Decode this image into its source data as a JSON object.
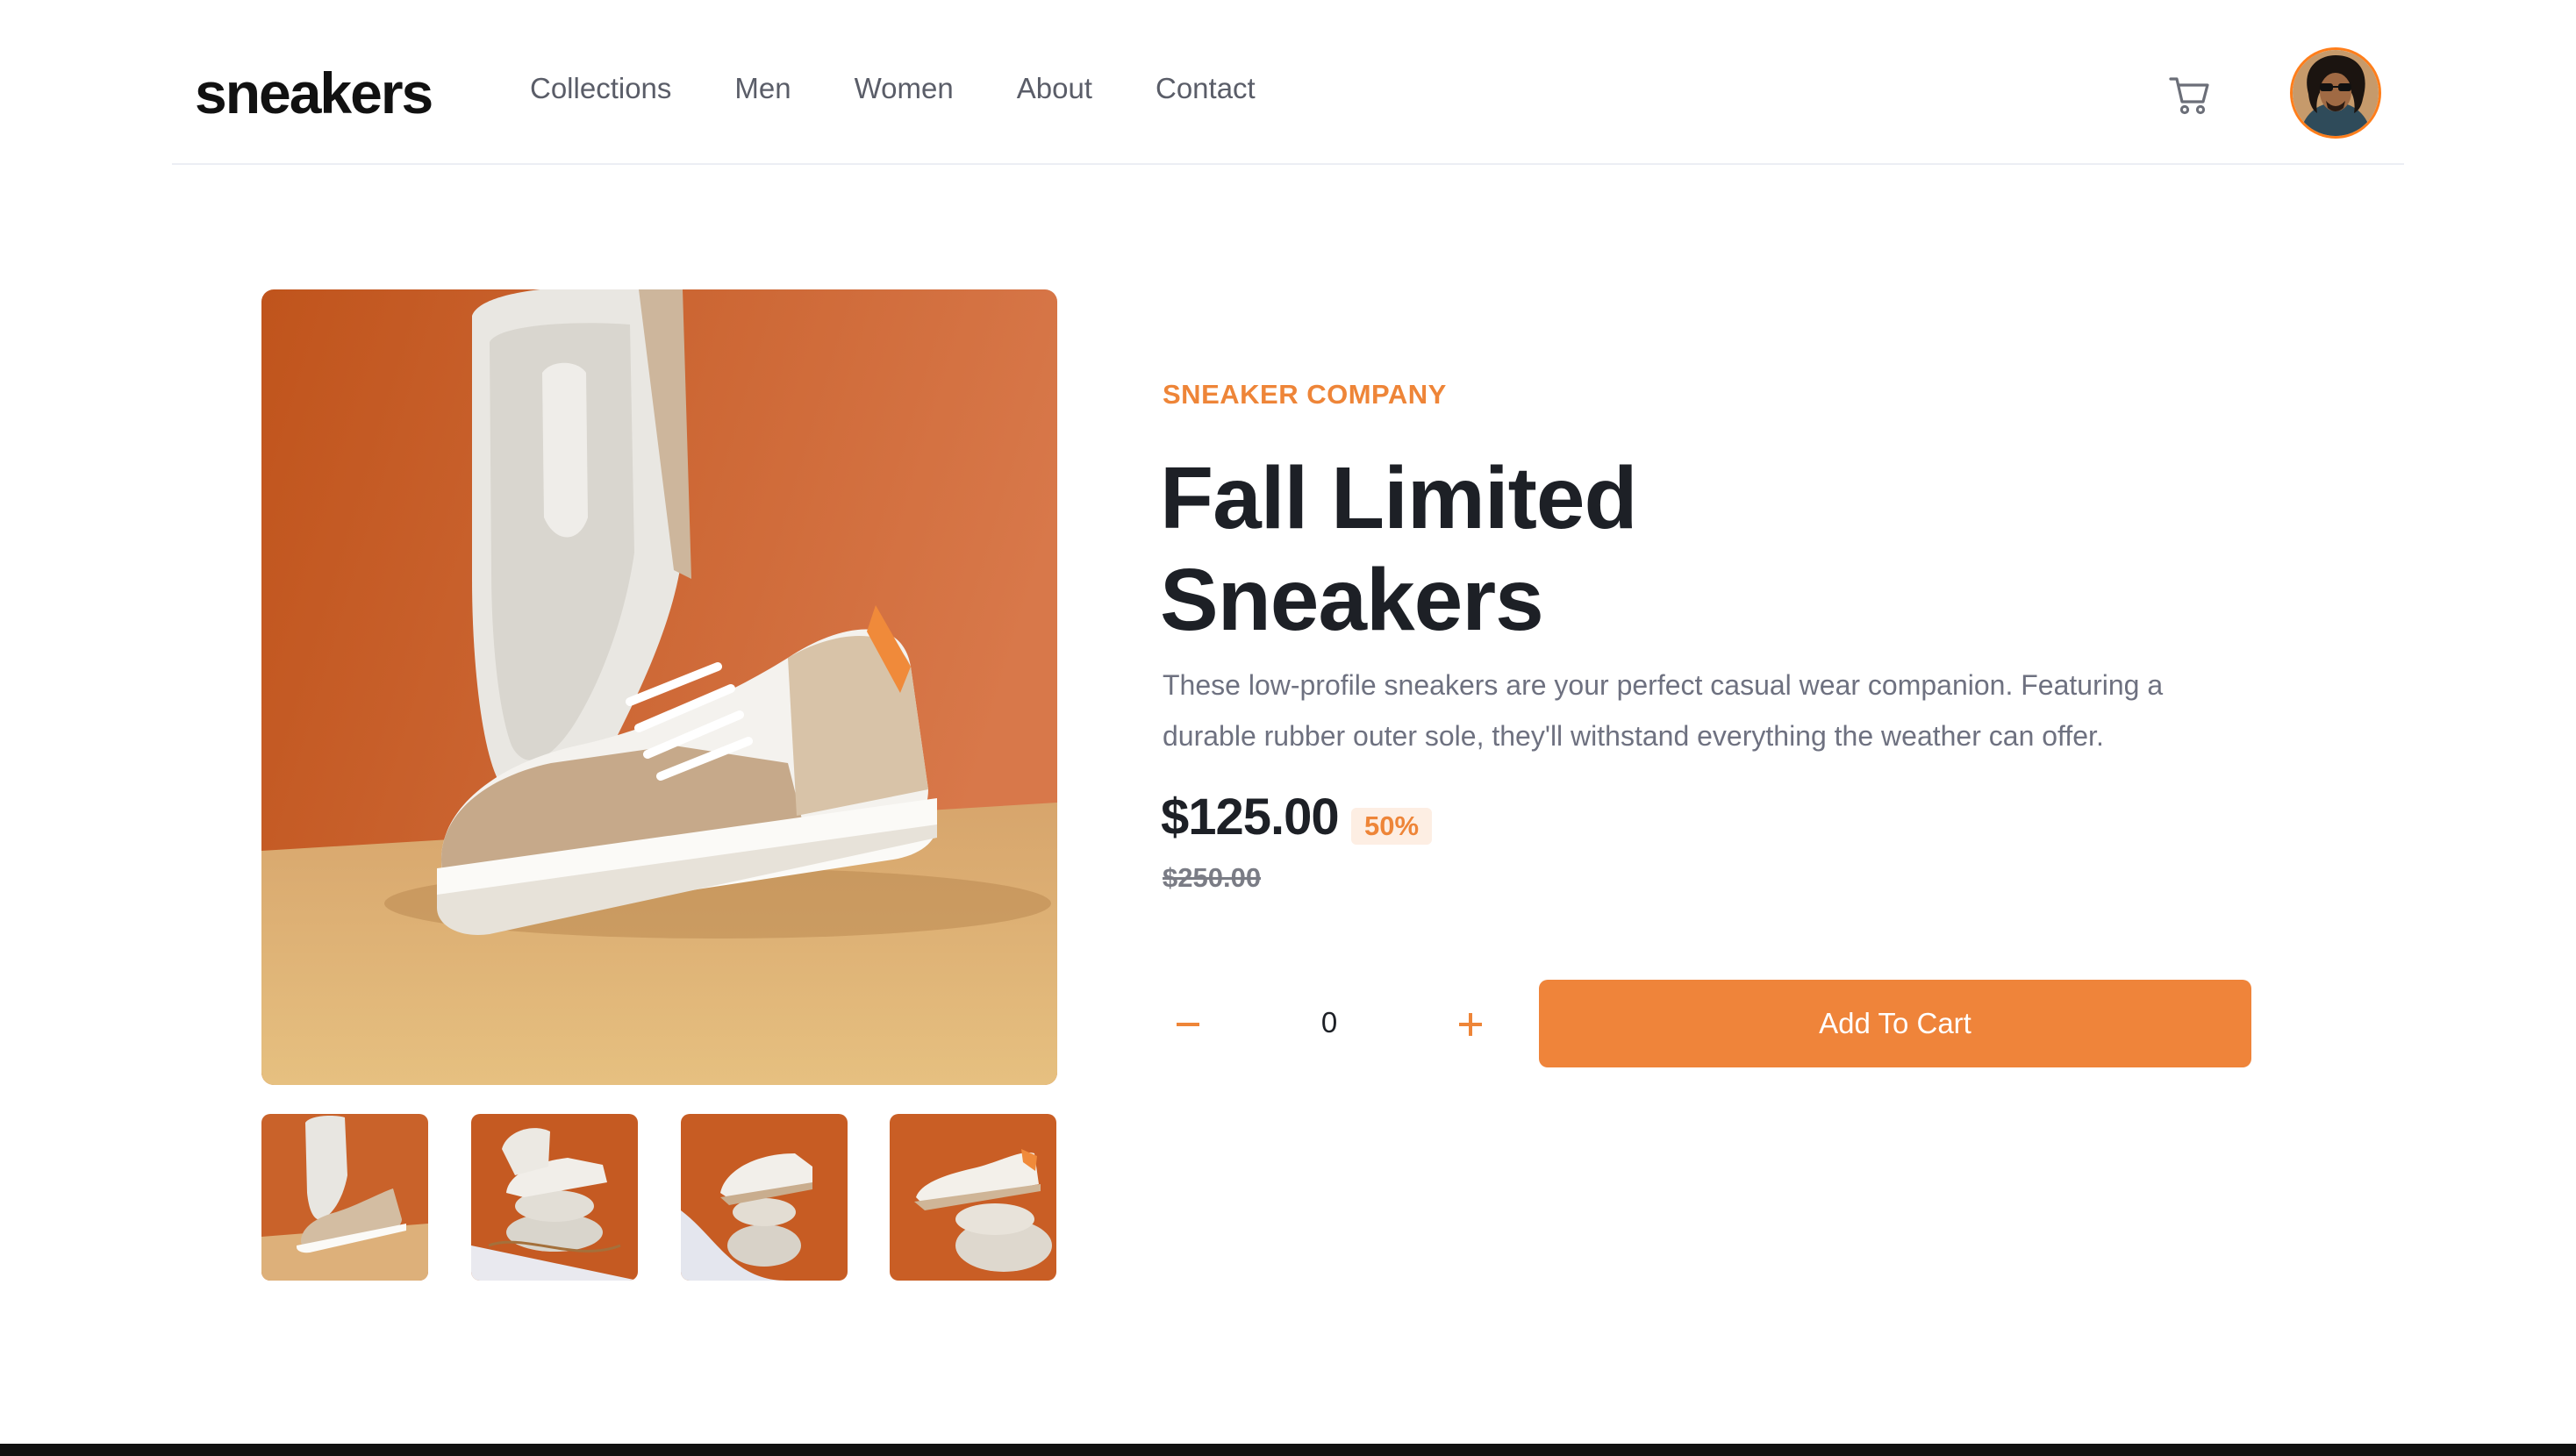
{
  "header": {
    "logo": "sneakers",
    "nav": [
      "Collections",
      "Men",
      "Women",
      "About",
      "Contact"
    ],
    "cart_icon": "cart-icon",
    "avatar_icon": "user-avatar"
  },
  "gallery": {
    "main_image": "sneaker-photo",
    "thumbnails": [
      "thumbnail-1",
      "thumbnail-2",
      "thumbnail-3",
      "thumbnail-4"
    ]
  },
  "product": {
    "company": "SNEAKER COMPANY",
    "title_line1": "Fall Limited",
    "title_line2": "Sneakers",
    "description": "These low-profile sneakers are your perfect casual wear companion. Featuring a durable rubber outer sole, they'll withstand everything the weather can offer.",
    "price": "$125.00",
    "discount": "50%",
    "original_price": "$250.00"
  },
  "cart_controls": {
    "minus_label": "−",
    "quantity": "0",
    "plus_label": "+",
    "add_to_cart_label": "Add To Cart"
  },
  "colors": {
    "accent": "#EE8538",
    "accent_light": "#FDEEE3",
    "text_dark": "#1D2026",
    "text_muted": "#6E7180"
  }
}
